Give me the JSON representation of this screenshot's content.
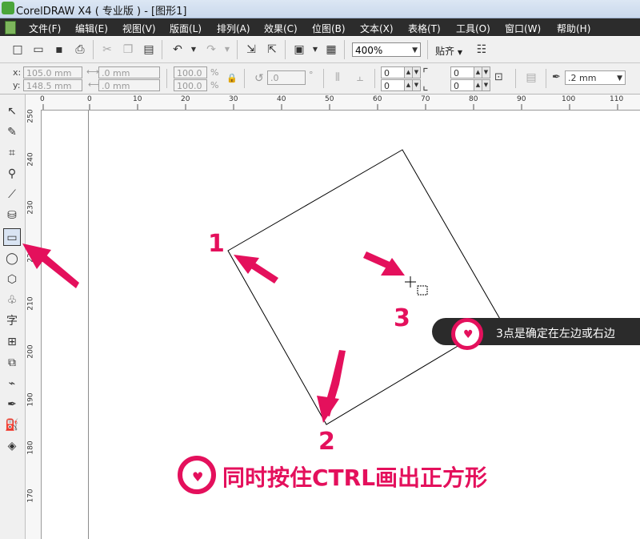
{
  "window": {
    "title": "CorelDRAW X4 ( 专业版 ) - [图形1]"
  },
  "menu": [
    "文件(F)",
    "编辑(E)",
    "视图(V)",
    "版面(L)",
    "排列(A)",
    "效果(C)",
    "位图(B)",
    "文本(X)",
    "表格(T)",
    "工具(O)",
    "窗口(W)",
    "帮助(H)"
  ],
  "toolbar": {
    "zoom": "400%",
    "snap_label": "贴齐"
  },
  "property_bar": {
    "x_label": "x:",
    "y_label": "y:",
    "x_value": "105.0 mm",
    "y_value": "148.5 mm",
    "width_value": ".0 mm",
    "height_value": ".0 mm",
    "scale_x": "100.0",
    "scale_y": "100.0",
    "percent": "%",
    "angle_value": ".0",
    "degree": "°",
    "corner_values": [
      "0",
      "0",
      "0",
      "0"
    ],
    "outline_width": ".2 mm"
  },
  "ruler_h_labels": [
    "0",
    "0",
    "10",
    "20",
    "30",
    "40",
    "50",
    "60",
    "70",
    "80",
    "90",
    "100",
    "110"
  ],
  "ruler_v_labels": [
    "250",
    "240",
    "230",
    "220",
    "210",
    "200",
    "190",
    "180",
    "170"
  ],
  "annotations": {
    "n1": "1",
    "n2": "2",
    "n3": "3",
    "callout": "3点是确定在左边或右边",
    "tip": "同时按住CTRL画出正方形"
  },
  "colors": {
    "accent": "#e4105c",
    "menubar": "#2c2c2c",
    "callout_bg": "#2b2b2b"
  }
}
